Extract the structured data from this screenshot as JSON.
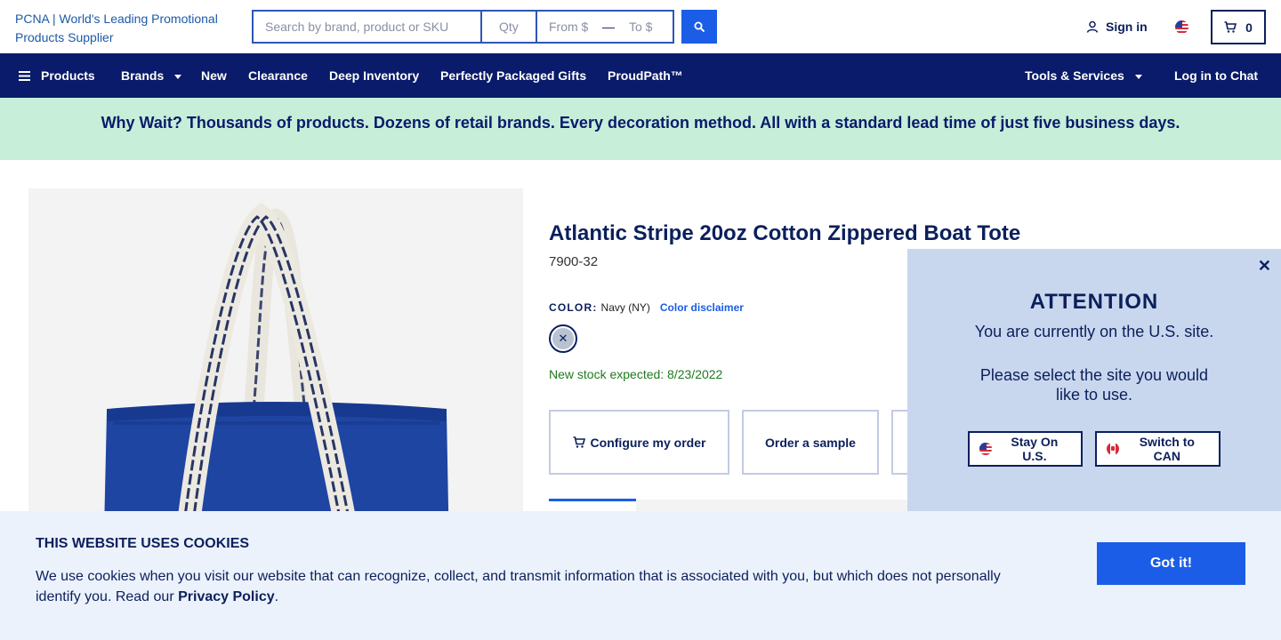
{
  "header": {
    "logo_alt": "PCNA | World's Leading Promotional Products Supplier",
    "search": {
      "keyword_placeholder": "Search by brand, product or SKU",
      "qty_placeholder": "Qty",
      "from_placeholder": "From $",
      "separator": "—",
      "to_placeholder": "To $"
    },
    "signin_label": "Sign in",
    "cart_count": "0"
  },
  "nav": {
    "items": [
      {
        "label": "Products"
      },
      {
        "label": "Brands"
      },
      {
        "label": "New"
      },
      {
        "label": "Clearance"
      },
      {
        "label": "Deep Inventory"
      },
      {
        "label": "Perfectly Packaged Gifts"
      },
      {
        "label": "ProudPath™"
      },
      {
        "label": "Tools & Services"
      },
      {
        "label": "Log in to Chat"
      }
    ]
  },
  "promo": {
    "text": "Why Wait? Thousands of products. Dozens of retail brands. Every decoration method. All with a standard lead time of just five business days."
  },
  "product": {
    "title": "Atlantic Stripe 20oz Cotton Zippered Boat Tote",
    "sku": "7900-32",
    "color_label": "COLOR:",
    "color_value": "Navy (NY)",
    "color_disclaimer": "Color disclaimer",
    "stock_note": "New stock expected: 8/23/2022",
    "configure_label": "Configure my order",
    "sample_label": "Order a sample"
  },
  "attention": {
    "title": "ATTENTION",
    "line1": "You are currently on the U.S. site.",
    "line2": "Please select the site you would like to use.",
    "stay_label": "Stay On U.S.",
    "switch_label": "Switch to CAN"
  },
  "cookie": {
    "title": "THIS WEBSITE USES COOKIES",
    "text": "We use cookies when you visit our website that can recognize, collect, and transmit information that is associated with you, but which does not personally identify you. Read our",
    "link": "Privacy Policy",
    "period": ".",
    "button": "Got it!"
  },
  "colors": {
    "navy": "#091b6a",
    "accent_blue": "#1b5de6",
    "promo_bg": "#c6eed9",
    "stock_green": "#1f7a1f",
    "modal_bg": "#c9d7ee",
    "cookie_bg": "#ecf2fb",
    "tote_blue": "#1f45a3"
  }
}
